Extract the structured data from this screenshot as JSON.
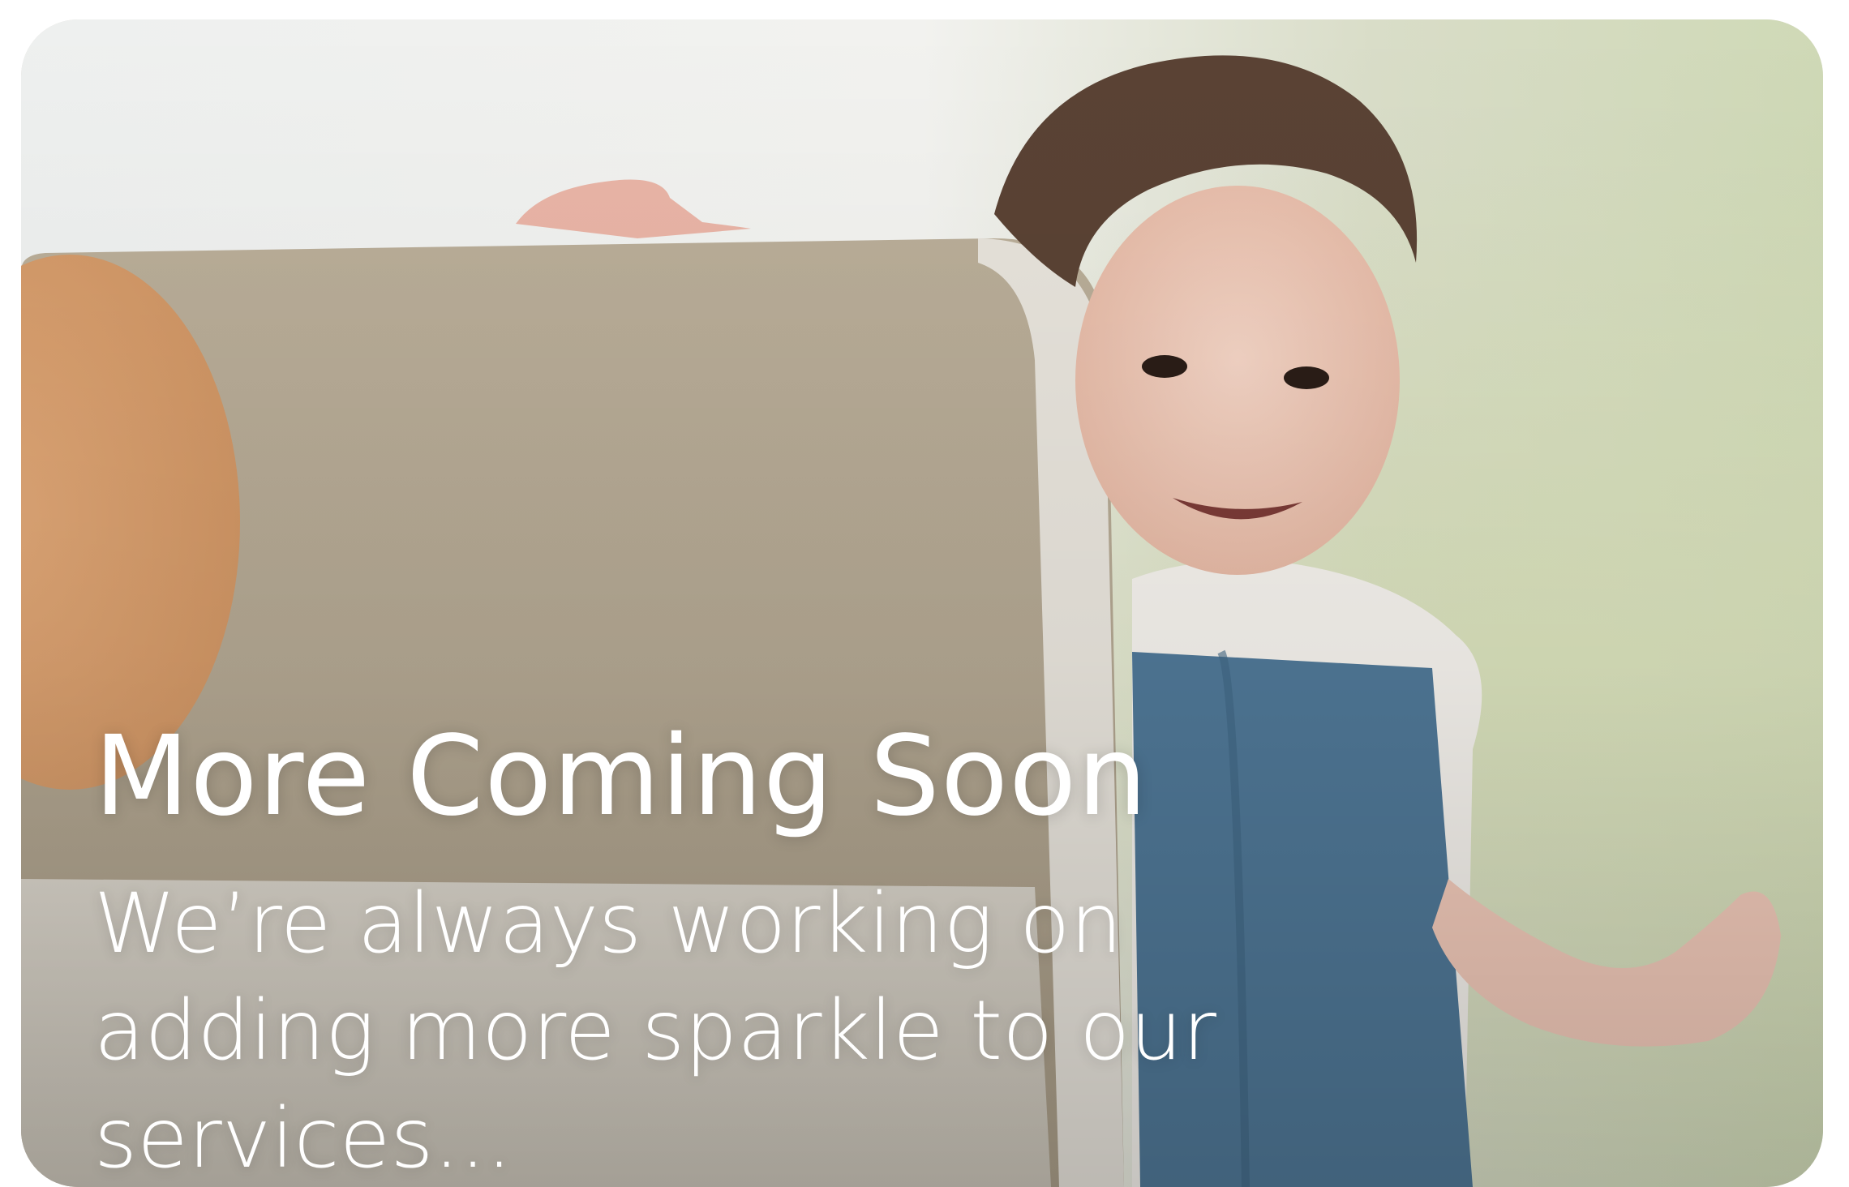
{
  "card": {
    "title": "More Coming Soon",
    "subtitle": "We’re always working on adding more sparkle to our services...",
    "image": "toddler-peeking-behind-armchair-photo"
  },
  "colors": {
    "text": "#ffffff",
    "background_light": "#e9ece9",
    "greenery": "#cfd9b6",
    "armchair": "#b7ab97",
    "overalls": "#4f7796"
  }
}
